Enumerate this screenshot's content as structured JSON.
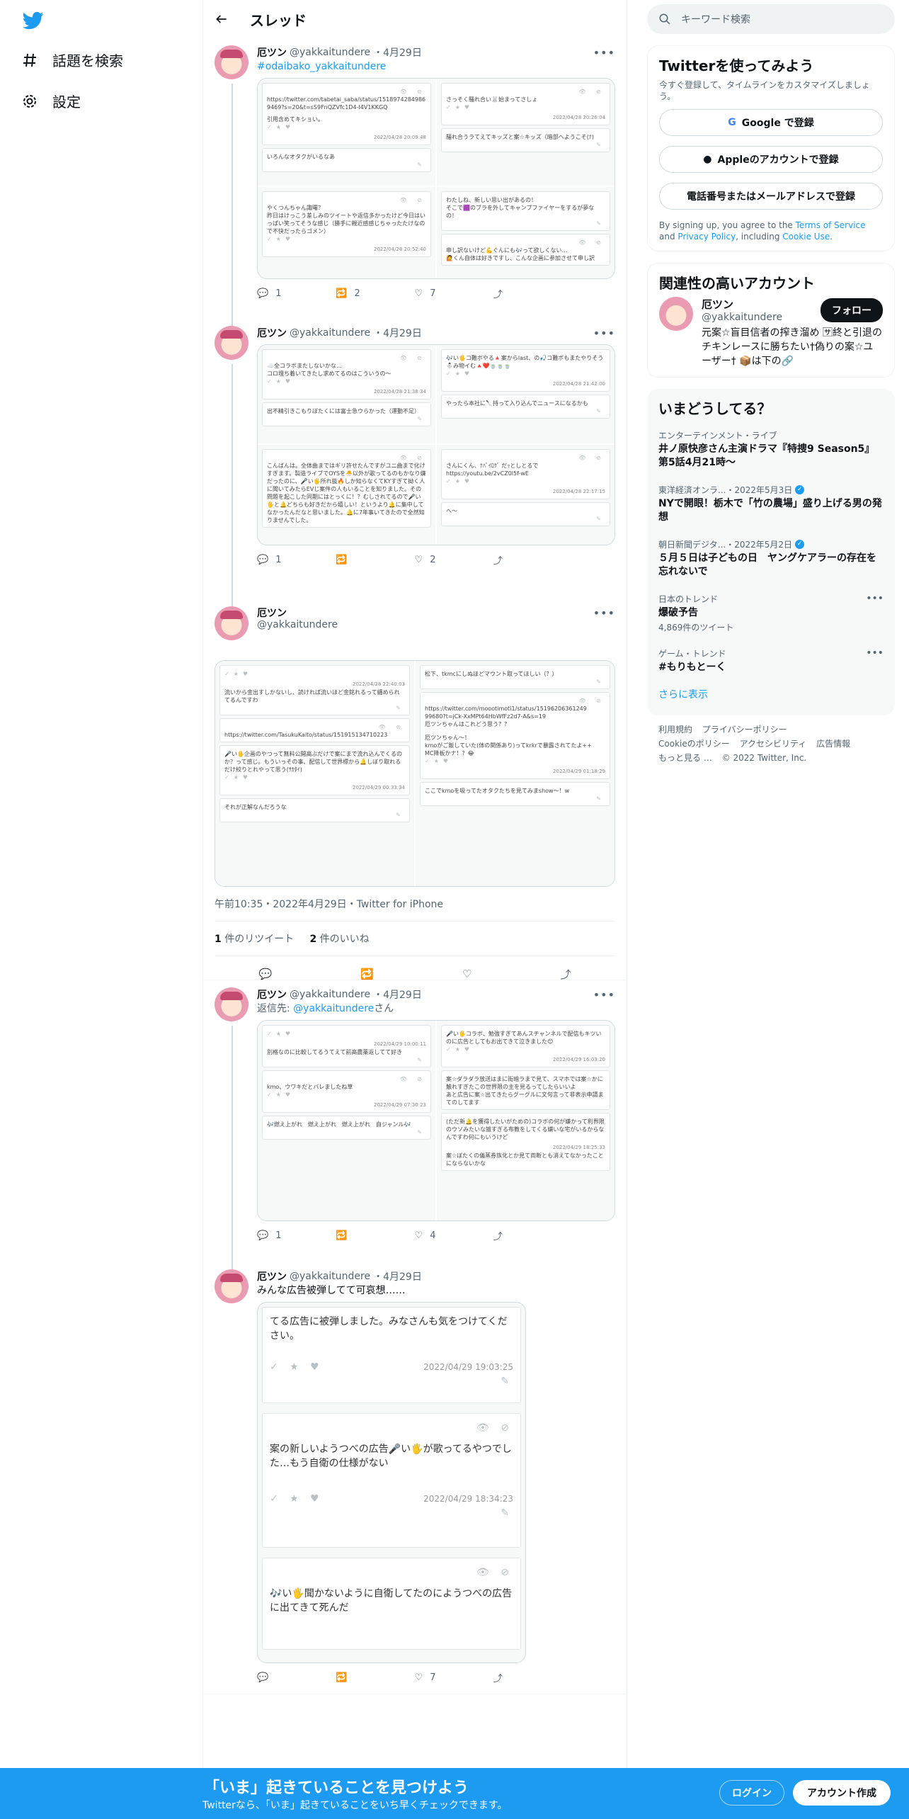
{
  "nav": {
    "explore": "話題を検索",
    "settings": "設定"
  },
  "header": {
    "title": "スレッド"
  },
  "tweets": [
    {
      "name": "厄ツン",
      "handle": "@yakkaitundere",
      "date": "・4月29日",
      "text": "#odaibako_yakkaitundere",
      "shots": [
        [
          "https://twitter.com/tabetai_saba/status/1518974284986 9469?s=20&t=sS9FnQZVfc1D4-I4V1KKGQ",
          "引用含めてキショい。",
          "いろんなオタクがいるなあ",
          "2022/04/28 20:09:48"
        ],
        [
          "さっそく騒れ合い🐰始まってさしょ",
          "騒れ合うラてえてキッズと案☆キッズ（暗部へようこそ(ﾅ)",
          "2022/04/28 20:26:04"
        ],
        [
          "やくつんちゃん諏曙？",
          "昨日はけっこう差しみのツイートや返信多かったけど今日はいっぱい笑ってそうな感じ（勝手に親近感感じちゃったたけなので不快だったらゴメン）",
          "2022/04/28 20:52:40"
        ],
        [
          "わたしね、新しい思い出があるの！",
          "そこで🟪のブラを外してキャンプファイヤーをするが夢なの！",
          "申し訳ないけど💪ぐんにも🎶って欲しくない…",
          "🙋くん自体は好きですし、こんな企画に参加させて申し訳"
        ]
      ],
      "counts": {
        "reply": "1",
        "retweet": "2",
        "like": "7"
      }
    },
    {
      "name": "厄ツン",
      "handle": "@yakkaitundere",
      "date": "・4月29日",
      "text": "",
      "shots": [
        [
          "☁️全コラボまたしないかな…",
          "コロ埋ち着いてきたし求めてるのはこういうの〜",
          "2022/04/28 21:38:34",
          "出不精引きこもりぼたくには富士急ウらかった（運動不足）"
        ],
        [
          "🎶い🖐コ難ボやる🔺案からlast、の🎣コ難ボもまたやりそう",
          "⛄み物イむ🔺❤️🍵🍵🍵",
          "2022/04/28 21:42:00",
          "やったら本社に🔪持って入り込んでニュースになるかも"
        ],
        [
          "こんばんは。全体曲まではギリ許せたんですがユニ曲まで化けすぎます。製造ライブでOYSを🐣以外が歌ってるのもかなり嫌だったのに、🎤い🖐所れ抜🔥しか知らなくてKYすぎて拗く人に聞いてみたらEVじ案件の人もいることを知りました。その問題を起こした同期にはとっくに！？むしされてるので🎤い🖐と🔔どちらも好きだから嬉しい！というより🔔に集中してなかったんだなと思いました。🔔に7年事いてきたので全然知りませんでした。"
        ],
        [
          "さんにくん、ﾅﾊﾞｲﾛｸﾞ だｯとしとるで",
          "https://youtu.be/2vCZ0l5f-wE",
          "2022/04/28 22:17:15",
          "へ〜"
        ]
      ],
      "counts": {
        "reply": "1",
        "retweet": "",
        "like": "2"
      }
    }
  ],
  "focus": {
    "name": "厄ツン",
    "handle": "@yakkaitundere",
    "shots": [
      [
        "2022/04/28 22:40:03",
        "流いから金出すしかないし、読ければ流いほど金銘れるって纏められてるんですわ",
        "https://twitter.com/TasukuKaito/status/151915134710223",
        "🎤い🖐企画のやつって無料公開高ぶだけで案にまで流れ込んでくるのか？って感じ。もういっその事、配信して世界標から🔔しぼり取れるだけ絞りとれやって思う(ｻｶﾀｲ)",
        "2022/04/29 00:33:34",
        "それが正解なんだろうな"
      ],
      [
        "松下、tkmcにしぬほどマウント取ってほしい（？）",
        "https://twitter.com/moootimoti1/status/15196206361249 99680?t=jCk-XxMPt64HbWfFz2d7-A&s=19",
        "厄ツンちゃんはこれどう思う？？",
        "厄ツンちゃん〜！",
        "kmoがご飯していた(体の関係あり)ってkrkrで暴露されてたよ++",
        "MC降板かナ！？😂",
        "2022/04/29 01:18:29",
        "ここでkmoを吸ってたオタクたちを見てみまshow〜！w"
      ]
    ],
    "time": "午前10:35・2022年4月29日・Twitter for iPhone",
    "retweets_num": "1",
    "retweets_label": "件のリツイート",
    "likes_num": "2",
    "likes_label": "件のいいね"
  },
  "reply1": {
    "name": "厄ツン",
    "handle": "@yakkaitundere",
    "date": "・4月29日",
    "reply_prefix": "返信先: ",
    "reply_to": "@yakkaitundere",
    "reply_suffix": "さん",
    "shots": [
      [
        "2022/04/29 10:00:11",
        "別格なのに比較してるうてえて前高農薬返してて好き"
      ],
      [
        "🎤い🖐コラボ、勉強すぎてあんスチャンネルで配信もキツいのに広告としてもお出てきて泣きました😊",
        "2022/04/29 16:03:20"
      ],
      [
        "kmo、ウワキだとバレましたね草",
        "2022/04/29 07:30:23",
        "🎶燃え上がれ　燃え上がれ　燃え上がれ　自ジャンル🎶"
      ],
      [
        "案☆ダラダラ放送はまに街暗ラまで見て、スマホでは案☆かに触れすぎたこの世界限の主を見るってしたらいいよ",
        "あと広告に案☆出てきたらグーグルに文句言って非表示申請まてのしてます",
        "(ただ新🔔を獲得したいがための)コラボの何が嫌かって利界限のウソみたいな雑すぎる布教をしてくる嫌いな宅がいるからなんですわ何にもいうけど",
        "2022/04/29 18:25:33",
        "案☆ぼたくの儀蒸券族化とか見て両断とも消えてなかったことにならないかな"
      ]
    ],
    "counts": {
      "reply": "1",
      "retweet": "",
      "like": "4"
    }
  },
  "reply2": {
    "name": "厄ツン",
    "handle": "@yakkaitundere",
    "date": "・4月29日",
    "text": "みんな広告被弾してて可哀想……",
    "cards": [
      {
        "text": "てる広告に被弾しました。みなさんも気をつけてください。",
        "ts": "2022/04/29 19:03:25"
      },
      {
        "text": "案の新しいようつべの広告🎤い🖐が歌ってるやつでした…もう自衛の仕様がない",
        "ts": "2022/04/29 18:34:23"
      },
      {
        "text": "🎶い🖐聞かないように自衛してたのにようつべの広告に出てきて死んだ",
        "ts": ""
      }
    ],
    "counts": {
      "reply": "",
      "retweet": "",
      "like": "7"
    }
  },
  "right": {
    "search_placeholder": "キーワード検索",
    "signup": {
      "title": "Twitterを使ってみよう",
      "sub": "今すぐ登録して、タイムラインをカスタマイズしましょう。",
      "google": "Google で登録",
      "apple": "Appleのアカウントで登録",
      "phone": "電話番号またはメールアドレスで登録",
      "legal_1": "By signing up, you agree to the ",
      "tos": "Terms of Service",
      "legal_2": " and ",
      "privacy": "Privacy Policy",
      "legal_3": ", including ",
      "cookie": "Cookie Use",
      "legal_4": "."
    },
    "related": {
      "title": "関連性の高いアカウント",
      "name": "厄ツン",
      "handle": "@yakkaitundere",
      "follow": "フォロー",
      "bio": "元案☆盲目信者の搾き溜め 🈂終と引退のチキンレースに勝ちたい†偽りの案☆ユーザー† 📦は下の🔗"
    },
    "trends": {
      "title": "いまどうしてる？",
      "items": [
        {
          "ctx": "エンターテインメント・ライブ",
          "title": "井ノ原快彦さん主演ドラマ『特捜9 Season5』第5話4月21時〜",
          "count": ""
        },
        {
          "ctx": "東洋経済オンラ...・2022年5月3日",
          "title": "NYで開眼！栃木で「竹の農場」盛り上げる男の発想",
          "count": ""
        },
        {
          "ctx": "朝日新聞デジタ...・2022年5月2日",
          "title": "５月５日は子どもの日　ヤングケアラーの存在を忘れないで",
          "count": ""
        },
        {
          "ctx": "日本のトレンド",
          "title": "爆破予告",
          "count": "4,869件のツイート"
        },
        {
          "ctx": "ゲーム・トレンド",
          "title": "#もりもとーく",
          "count": ""
        }
      ],
      "more": "さらに表示"
    },
    "footer": [
      "利用規約",
      "プライバシーポリシー",
      "Cookieのポリシー",
      "アクセシビリティ",
      "広告情報",
      "もっと見る …",
      "© 2022 Twitter, Inc."
    ]
  },
  "bottom": {
    "title": "「いま」起きていることを見つけよう",
    "sub": "Twitterなら、「いま」起きていることをいち早くチェックできます。",
    "login": "ログイン",
    "signup": "アカウント作成"
  },
  "colors": {
    "accent": "#1d9bf0",
    "text": "#0f1419",
    "muted": "#536471"
  }
}
